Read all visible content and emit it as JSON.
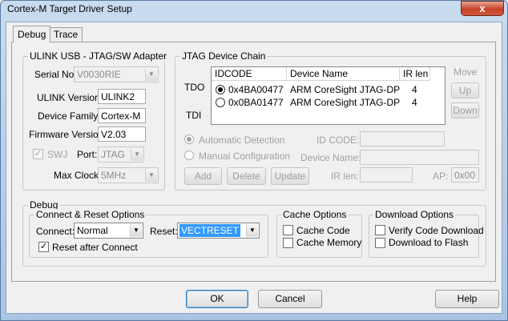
{
  "window": {
    "title": "Cortex-M Target Driver Setup",
    "close_glyph": "x"
  },
  "tabs": [
    {
      "label": "Debug",
      "active": true
    },
    {
      "label": "Trace",
      "active": false
    }
  ],
  "adapter": {
    "title": "ULINK USB - JTAG/SW Adapter",
    "serial_label": "Serial No:",
    "serial_value": "V0030RIE",
    "version_label": "ULINK Version:",
    "version_value": "ULINK2",
    "family_label": "Device Family:",
    "family_value": "Cortex-M",
    "firmware_label": "Firmware Version:",
    "firmware_value": "V2.03",
    "swj_label": "SWJ",
    "swj_checked": true,
    "port_label": "Port:",
    "port_value": "JTAG",
    "clock_label": "Max Clock:",
    "clock_value": "5MHz"
  },
  "jtag": {
    "title": "JTAG Device Chain",
    "tdo_label": "TDO",
    "tdi_label": "TDI",
    "columns": [
      "IDCODE",
      "Device Name",
      "IR len"
    ],
    "rows": [
      {
        "idcode": "0x4BA00477",
        "name": "ARM CoreSight JTAG-DP",
        "irlen": "4",
        "selected": true
      },
      {
        "idcode": "0x0BA01477",
        "name": "ARM CoreSight JTAG-DP",
        "irlen": "4",
        "selected": false
      }
    ],
    "move_label": "Move",
    "up_label": "Up",
    "down_label": "Down",
    "auto_label": "Automatic Detection",
    "auto_selected": true,
    "manual_label": "Manual Configuration",
    "idcode_label": "ID CODE:",
    "idcode_value": "",
    "devname_label": "Device Name:",
    "devname_value": "",
    "irlen_label": "IR len:",
    "irlen_value": "",
    "ap_label": "AP:",
    "ap_value": "0x00",
    "add_label": "Add",
    "delete_label": "Delete",
    "update_label": "Update"
  },
  "debug": {
    "title": "Debug",
    "connect_group_title": "Connect & Reset Options",
    "connect_label": "Connect:",
    "connect_value": "Normal",
    "reset_label": "Reset:",
    "reset_value": "VECTRESET",
    "reset_after_label": "Reset after Connect",
    "reset_after_checked": true,
    "cache_title": "Cache Options",
    "cache_code_label": "Cache Code",
    "cache_code_checked": false,
    "cache_memory_label": "Cache Memory",
    "cache_memory_checked": false,
    "download_title": "Download Options",
    "verify_label": "Verify Code Download",
    "verify_checked": false,
    "flash_label": "Download to Flash",
    "flash_checked": false
  },
  "footer": {
    "ok_label": "OK",
    "cancel_label": "Cancel",
    "help_label": "Help"
  },
  "colors": {
    "selection": "#3399ff",
    "titlebar": "#b9d1ea",
    "close": "#c7432a"
  }
}
